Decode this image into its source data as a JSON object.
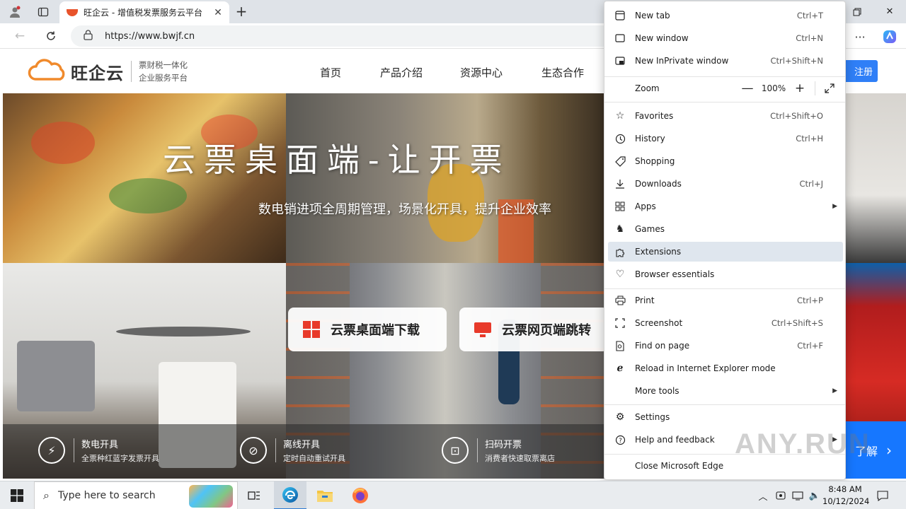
{
  "browser": {
    "tab_title": "旺企云 - 增值税发票服务云平台",
    "url": "https://www.bwjf.cn"
  },
  "site": {
    "logo_text": "旺企云",
    "tagline_1": "票财税一体化",
    "tagline_2": "企业服务平台",
    "nav": [
      "首页",
      "产品介绍",
      "资源中心",
      "生态合作"
    ],
    "register_label": "注册",
    "hero_title": "云票桌面端-让开票",
    "hero_subtitle": "数电销进项全周期管理，场景化开具，提升企业效率",
    "cta_desktop": "云票桌面端下载",
    "cta_web": "云票网页端跳转",
    "features": [
      {
        "title": "数电开具",
        "desc": "全票种红蓝字发票开具",
        "icon": "lightning-icon"
      },
      {
        "title": "离线开具",
        "desc": "定时自动重试开具",
        "icon": "unlink-icon"
      },
      {
        "title": "扫码开票",
        "desc": "消费者快速取票离店",
        "icon": "scan-icon"
      }
    ],
    "right_cta": "了解"
  },
  "menu": {
    "items": [
      {
        "label": "New tab",
        "shortcut": "Ctrl+T",
        "icon": "new-tab-icon"
      },
      {
        "label": "New window",
        "shortcut": "Ctrl+N",
        "icon": "new-window-icon"
      },
      {
        "label": "New InPrivate window",
        "shortcut": "Ctrl+Shift+N",
        "icon": "inprivate-icon"
      },
      {
        "label": "Favorites",
        "shortcut": "Ctrl+Shift+O",
        "icon": "star-icon"
      },
      {
        "label": "History",
        "shortcut": "Ctrl+H",
        "icon": "history-icon"
      },
      {
        "label": "Shopping",
        "shortcut": "",
        "icon": "tag-icon"
      },
      {
        "label": "Downloads",
        "shortcut": "Ctrl+J",
        "icon": "download-icon"
      },
      {
        "label": "Apps",
        "shortcut": "",
        "icon": "apps-icon"
      },
      {
        "label": "Games",
        "shortcut": "",
        "icon": "games-icon"
      },
      {
        "label": "Extensions",
        "shortcut": "",
        "icon": "puzzle-icon"
      },
      {
        "label": "Browser essentials",
        "shortcut": "",
        "icon": "heart-pulse-icon"
      },
      {
        "label": "Print",
        "shortcut": "Ctrl+P",
        "icon": "print-icon"
      },
      {
        "label": "Screenshot",
        "shortcut": "Ctrl+Shift+S",
        "icon": "screenshot-icon"
      },
      {
        "label": "Find on page",
        "shortcut": "Ctrl+F",
        "icon": "find-icon"
      },
      {
        "label": "Reload in Internet Explorer mode",
        "shortcut": "",
        "icon": "ie-icon"
      },
      {
        "label": "More tools",
        "shortcut": "",
        "icon": ""
      },
      {
        "label": "Settings",
        "shortcut": "",
        "icon": "gear-icon"
      },
      {
        "label": "Help and feedback",
        "shortcut": "",
        "icon": "help-icon"
      },
      {
        "label": "Close Microsoft Edge",
        "shortcut": "",
        "icon": ""
      }
    ],
    "zoom_label": "Zoom",
    "zoom_value": "100%",
    "zoom_minus": "—",
    "zoom_plus": "+"
  },
  "taskbar": {
    "search_placeholder": "Type here to search",
    "time": "8:48 AM",
    "date": "10/12/2024"
  },
  "watermark": "ANY.RUN"
}
